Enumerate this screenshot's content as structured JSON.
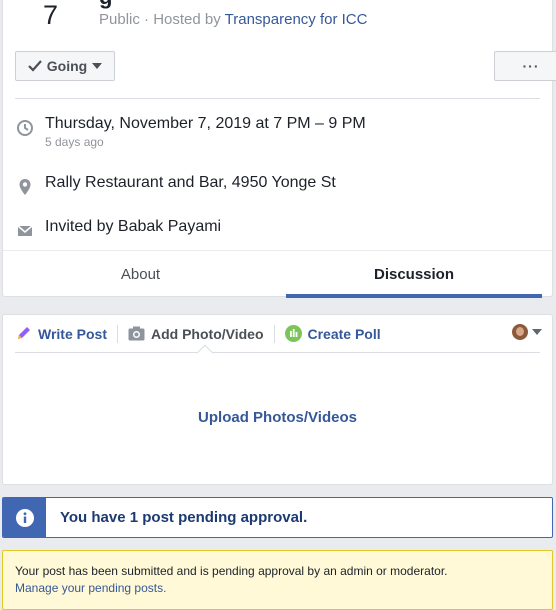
{
  "event": {
    "date_number": "7",
    "title_fragment": "g",
    "privacy": "Public",
    "hosted_prefix": "· Hosted by",
    "host": "Transparency for ICC",
    "going_label": "Going",
    "more_label": "···",
    "datetime": "Thursday, November 7, 2019 at 7 PM – 9 PM",
    "relative_time": "5 days ago",
    "location": "Rally Restaurant and Bar, 4950 Yonge St",
    "invited_by": "Invited by Babak Payami"
  },
  "tabs": [
    {
      "label": "About",
      "active": false
    },
    {
      "label": "Discussion",
      "active": true
    }
  ],
  "composer": {
    "write_post": "Write Post",
    "add_photo": "Add Photo/Video",
    "create_poll": "Create Poll",
    "upload_link": "Upload Photos/Videos"
  },
  "pending": {
    "message": "You have 1 post pending approval."
  },
  "moderation": {
    "note": "Your post has been submitted and is pending approval by an admin or moderator.",
    "link": "Manage your pending posts."
  },
  "colors": {
    "accent": "#4267b2",
    "link": "#365899",
    "warning_bg": "#fff9d7"
  }
}
